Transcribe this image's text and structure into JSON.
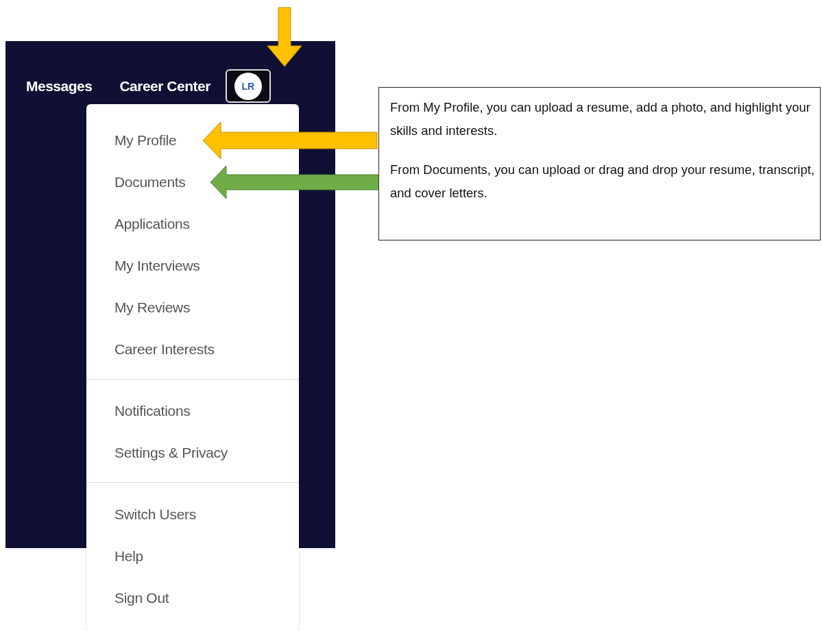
{
  "nav": {
    "links": [
      "Messages",
      "Career Center"
    ],
    "avatar": "LR"
  },
  "menu": {
    "groups": [
      [
        "My Profile",
        "Documents",
        "Applications",
        "My Interviews",
        "My Reviews",
        "Career Interests"
      ],
      [
        "Notifications",
        "Settings & Privacy"
      ],
      [
        "Switch Users",
        "Help",
        "Sign Out"
      ]
    ]
  },
  "callout": {
    "paragraphs": [
      "From My Profile, you can upload a resume, add a photo, and highlight your skills and interests.",
      "From Documents, you can upload or drag and drop your resume, transcript, and cover letters."
    ]
  }
}
